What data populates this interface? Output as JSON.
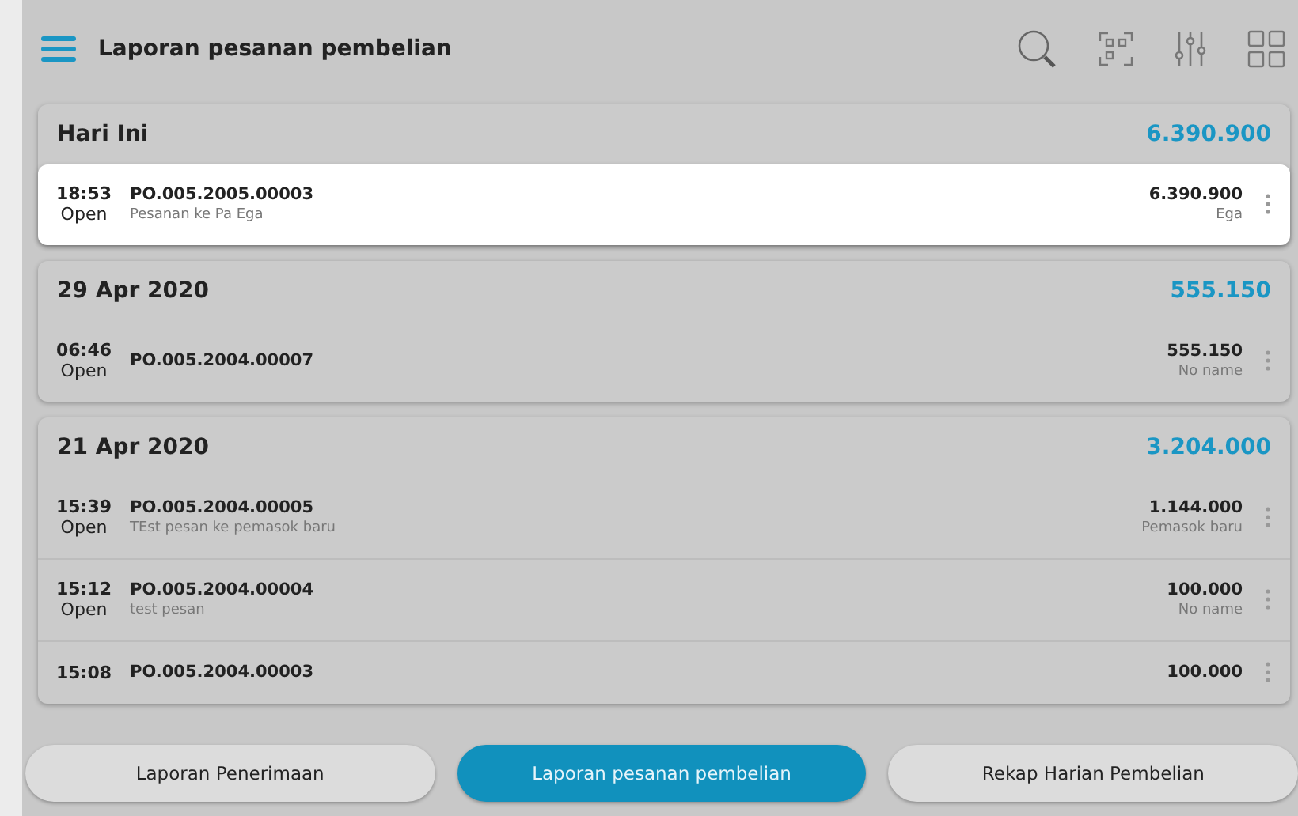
{
  "app_bar": {
    "title": "Laporan pesanan pembelian"
  },
  "groups": [
    {
      "title": "Hari Ini",
      "total": "6.390.900",
      "orders": [
        {
          "time": "18:53",
          "status": "Open",
          "number": "PO.005.2005.00003",
          "note": "Pesanan ke Pa Ega",
          "amount": "6.390.900",
          "supplier": "Ega",
          "selected": true
        }
      ]
    },
    {
      "title": "29 Apr 2020",
      "total": "555.150",
      "orders": [
        {
          "time": "06:46",
          "status": "Open",
          "number": "PO.005.2004.00007",
          "amount": "555.150",
          "supplier": "No name",
          "selected": false
        }
      ]
    },
    {
      "title": "21 Apr 2020",
      "total": "3.204.000",
      "orders": [
        {
          "time": "15:39",
          "status": "Open",
          "number": "PO.005.2004.00005",
          "note": "TEst pesan ke pemasok baru",
          "amount": "1.144.000",
          "supplier": "Pemasok baru",
          "selected": false
        },
        {
          "time": "15:12",
          "status": "Open",
          "number": "PO.005.2004.00004",
          "note": "test pesan",
          "amount": "100.000",
          "supplier": "No name",
          "selected": false
        },
        {
          "time": "15:08",
          "number": "PO.005.2004.00003",
          "amount": "100.000",
          "selected": false
        }
      ]
    }
  ],
  "bottom_tabs": [
    {
      "label": "Laporan Penerimaan",
      "selected": false
    },
    {
      "label": "Laporan pesanan pembelian",
      "selected": true
    },
    {
      "label": "Rekap Harian Pembelian",
      "selected": false
    }
  ]
}
